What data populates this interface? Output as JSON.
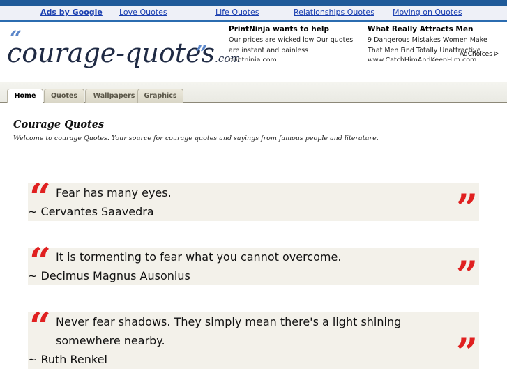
{
  "top_links": {
    "ads_by_google": "Ads by Google",
    "links": [
      "Love Quotes",
      "Life Quotes",
      "Relationships Quotes",
      "Moving on Quotes"
    ]
  },
  "logo": {
    "open_quote": "“",
    "brand": "courage-quotes",
    "tld": ".com",
    "close_quote": "”"
  },
  "ads": [
    {
      "title": "PrintNinja wants to help",
      "text": "Our prices are wicked low Our quotes are instant and painless",
      "url": "printninja.com"
    },
    {
      "title": "What Really Attracts Men",
      "text": "9 Dangerous Mistakes Women Make That Men Find Totally Unattractive.",
      "url": "www.CatchHimAndKeepHim.com"
    }
  ],
  "adchoices": {
    "label": "AdChoices",
    "icon": "ᐅ"
  },
  "tabs": [
    {
      "label": "Home",
      "active": true
    },
    {
      "label": "Quotes",
      "active": false
    },
    {
      "label": "Wallpapers",
      "active": false
    },
    {
      "label": "Graphics",
      "active": false
    }
  ],
  "page": {
    "title": "Courage Quotes",
    "subtitle": "Welcome to courage Quotes. Your source for courage quotes and sayings from famous people and literature."
  },
  "quotes": [
    {
      "text": "Fear has many eyes.",
      "author": "~ Cervantes Saavedra"
    },
    {
      "text": "It is tormenting to fear what you cannot overcome.",
      "author": "~ Decimus Magnus Ausonius"
    },
    {
      "text": "Never fear shadows. They simply mean there's a light shining somewhere nearby.",
      "author": "~ Ruth Renkel"
    }
  ],
  "quote_marks": {
    "open": "“",
    "close": "”"
  },
  "colors": {
    "quote_mark": "#e02020",
    "link": "#1a3fb0",
    "quote_bg": "#f3f1ea"
  }
}
